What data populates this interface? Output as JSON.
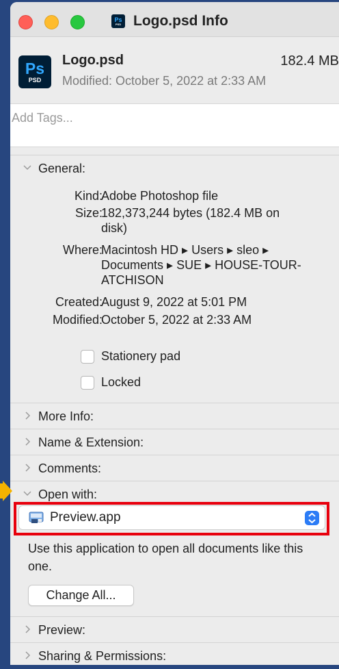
{
  "window": {
    "title": "Logo.psd Info"
  },
  "file": {
    "name": "Logo.psd",
    "size": "182.4 MB",
    "modified": "Modified: October 5, 2022 at 2:33 AM",
    "icon_text": "Ps",
    "icon_subtext": "PSD"
  },
  "tags": {
    "placeholder": "Add Tags..."
  },
  "general": {
    "label": "General:",
    "rows": [
      {
        "key": "Kind:",
        "value": "Adobe Photoshop file"
      },
      {
        "key": "Size:",
        "value": "182,373,244 bytes (182.4 MB on disk)"
      },
      {
        "key": "Where:",
        "value": "Macintosh HD ▸ Users ▸ sleo ▸ Documents ▸ SUE ▸ HOUSE-TOUR-ATCHISON"
      },
      {
        "key": "Created:",
        "value": "August 9, 2022 at 5:01 PM"
      },
      {
        "key": "Modified:",
        "value": "October 5, 2022 at 2:33 AM"
      }
    ],
    "stationery": "Stationery pad",
    "locked": "Locked"
  },
  "sections": {
    "more_info": "More Info:",
    "name_ext": "Name & Extension:",
    "comments": "Comments:",
    "open_with": "Open with:",
    "preview": "Preview:",
    "sharing": "Sharing & Permissions:"
  },
  "open_with": {
    "app": "Preview.app",
    "description": "Use this application to open all documents like this one.",
    "button": "Change All..."
  },
  "colors": {
    "highlight": "#e8000d",
    "arrow": "#f5b300",
    "background": "#27467f"
  }
}
